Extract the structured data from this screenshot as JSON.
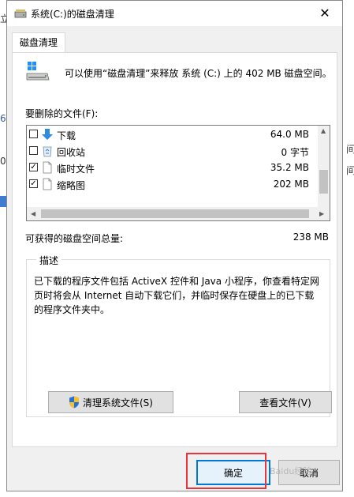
{
  "window": {
    "title": "系统(C:)的磁盘清理",
    "close_glyph": "✕"
  },
  "tab": {
    "label": "磁盘清理"
  },
  "summary": "可以使用“磁盘清理”来释放 系统 (C:) 上的 402 MB 磁盘空间。",
  "file_list": {
    "label": "要删除的文件(F):",
    "items": [
      {
        "name": "下载",
        "size": "64.0 MB",
        "checked": false,
        "icon": "download-arrow-icon"
      },
      {
        "name": "回收站",
        "size": "0 字节",
        "checked": false,
        "icon": "recycle-bin-icon"
      },
      {
        "name": "临时文件",
        "size": "35.2 MB",
        "checked": true,
        "icon": "file-icon"
      },
      {
        "name": "缩略图",
        "size": "202 MB",
        "checked": true,
        "icon": "file-icon"
      }
    ]
  },
  "total": {
    "label": "可获得的磁盘空间总量:",
    "value": "238 MB"
  },
  "description": {
    "title": "描述",
    "text": "已下载的程序文件包括 ActiveX 控件和 Java 小程序，你查看特定网页时将会从 Internet 自动下载它们，并临时保存在硬盘上的已下载的程序文件夹中。"
  },
  "buttons": {
    "clean_system": "清理系统文件(S)",
    "view_files": "查看文件(V)",
    "ok": "确定",
    "cancel": "取消"
  },
  "watermark": "Baidu经验",
  "colors": {
    "highlight": "#e8343a",
    "ok_border": "#0078d7"
  }
}
